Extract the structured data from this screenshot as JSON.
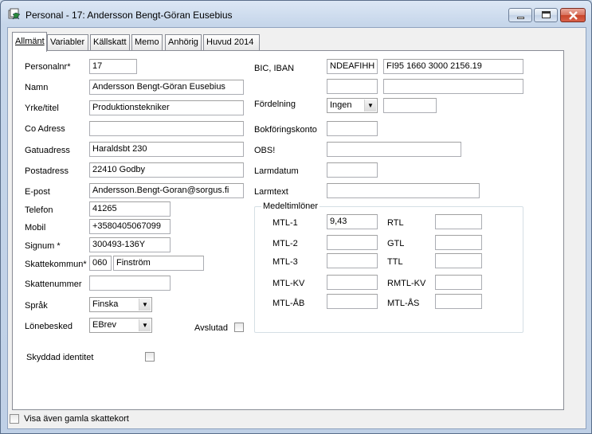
{
  "window": {
    "title": "Personal - 17: Andersson Bengt-Göran Eusebius"
  },
  "tabs": [
    {
      "label": "Allmänt"
    },
    {
      "label": "Variabler"
    },
    {
      "label": "Källskatt"
    },
    {
      "label": "Memo"
    },
    {
      "label": "Anhörig"
    },
    {
      "label": "Huvud 2014"
    }
  ],
  "form": {
    "personalnr": {
      "label": "Personalnr*",
      "value": "17"
    },
    "namn": {
      "label": "Namn",
      "value": "Andersson Bengt-Göran Eusebius"
    },
    "yrke": {
      "label": "Yrke/titel",
      "value": "Produktionstekniker"
    },
    "coadress": {
      "label": "Co Adress",
      "value": ""
    },
    "gatuadress": {
      "label": "Gatuadress",
      "value": "Haraldsbt 230"
    },
    "postadress": {
      "label": "Postadress",
      "value": "22410  Godby"
    },
    "epost": {
      "label": "E-post",
      "value": "Andersson.Bengt-Goran@sorgus.fi"
    },
    "telefon": {
      "label": "Telefon",
      "value": "41265"
    },
    "mobil": {
      "label": "Mobil",
      "value": "+3580405067099"
    },
    "signum": {
      "label": "Signum *",
      "value": "300493-136Y"
    },
    "skattekommun": {
      "label": "Skattekommun*",
      "code": "060",
      "name": "Finström"
    },
    "skattenummer": {
      "label": "Skattenummer",
      "value": ""
    },
    "sprak": {
      "label": "Språk",
      "value": "Finska"
    },
    "lonebesked": {
      "label": "Lönebesked",
      "value": "EBrev"
    },
    "avslutad": {
      "label": "Avslutad"
    },
    "skyddad": {
      "label": "Skyddad identitet"
    },
    "bic": {
      "label": "BIC, IBAN",
      "bic": "NDEAFIHH",
      "iban": "FI95 1660 3000 2156.19"
    },
    "fordelning": {
      "label": "Fördelning",
      "value": "Ingen"
    },
    "bokforingskonto": {
      "label": "Bokföringskonto",
      "value": ""
    },
    "obs": {
      "label": "OBS!",
      "value": ""
    },
    "larmdatum": {
      "label": "Larmdatum",
      "value": ""
    },
    "larmtext": {
      "label": "Larmtext",
      "value": ""
    }
  },
  "medeltimloner": {
    "title": "Medeltimlöner",
    "rows": [
      {
        "left_label": "MTL-1",
        "left_value": "9,43",
        "right_label": "RTL",
        "right_value": ""
      },
      {
        "left_label": "MTL-2",
        "left_value": "",
        "right_label": "GTL",
        "right_value": ""
      },
      {
        "left_label": "MTL-3",
        "left_value": "",
        "right_label": "TTL",
        "right_value": ""
      },
      {
        "left_label": "MTL-KV",
        "left_value": "",
        "right_label": "RMTL-KV",
        "right_value": ""
      },
      {
        "left_label": "MTL-ÅB",
        "left_value": "",
        "right_label": "MTL-ÅS",
        "right_value": ""
      }
    ]
  },
  "footer": {
    "visa_label": "Visa även gamla skattekort"
  },
  "colors": {
    "title_bg": "#c6d6ea",
    "close_button": "#c8452b",
    "panel": "#ffffff"
  }
}
